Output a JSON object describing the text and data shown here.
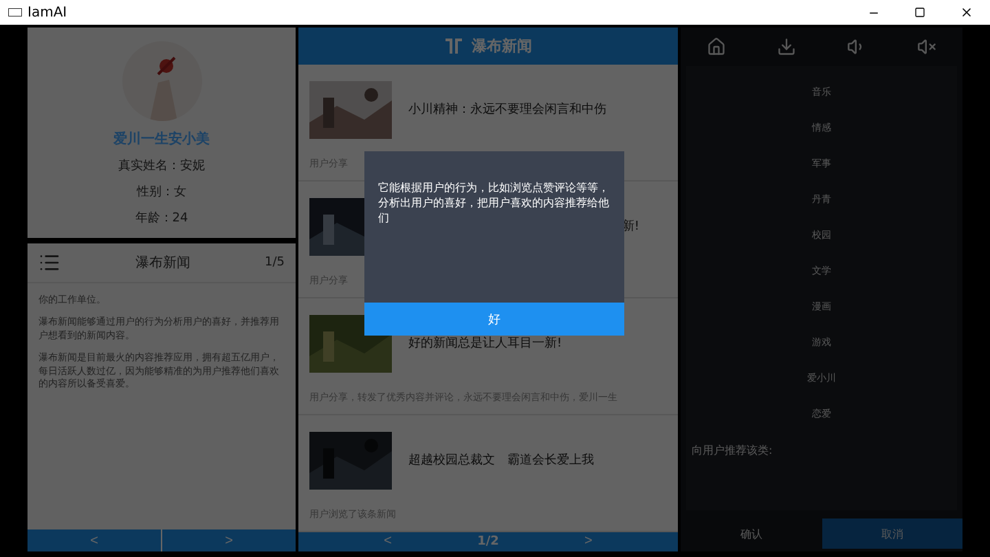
{
  "window": {
    "title": "IamAI"
  },
  "profile": {
    "nickname": "爱川一生安小美",
    "fields": [
      "真实姓名：安妮",
      "性别：女",
      "年龄：24"
    ]
  },
  "intro": {
    "title": "瀑布新闻",
    "page": "1/5",
    "paragraphs": [
      "你的工作单位。",
      "瀑布新闻能够通过用户的行为分析用户的喜好，并推荐用户想看到的新闻内容。",
      "瀑布新闻是目前最火的内容推荐应用，拥有超五亿用户，每日活跃人数过亿，因为能够精准的为用户推荐他们喜欢的内容所以备受喜爱。"
    ],
    "prev": "<",
    "next": ">"
  },
  "feed": {
    "title": "瀑布新闻",
    "items": [
      {
        "kind": "full",
        "title": "小川精神：永远不要理会闲言和中伤",
        "desc": "用户分享"
      },
      {
        "kind": "partial",
        "title": "新!",
        "desc": "用户分享"
      },
      {
        "kind": "full",
        "title": "好的新闻总是让人耳目一新!",
        "desc": "用户分享，转发了优秀内容并评论，永远不要理会闲言和中伤，爱川一生"
      },
      {
        "kind": "full",
        "title": "超越校园总裁文　霸道会长爱上我",
        "desc": "用户浏览了该条新闻"
      }
    ],
    "prev": "<",
    "page": "1/2",
    "next": ">"
  },
  "categories": {
    "items": [
      "音乐",
      "情感",
      "军事",
      "丹青",
      "校园",
      "文学",
      "漫画",
      "游戏",
      "爱小川",
      "恋爱"
    ],
    "prompt": "向用户推荐该类:",
    "confirm": "确认",
    "cancel": "取消"
  },
  "dialog": {
    "message": "它能根据用户的行为，比如浏览点赞评论等等，分析出用户的喜好，把用户喜欢的内容推荐给他们",
    "ok": "好"
  }
}
